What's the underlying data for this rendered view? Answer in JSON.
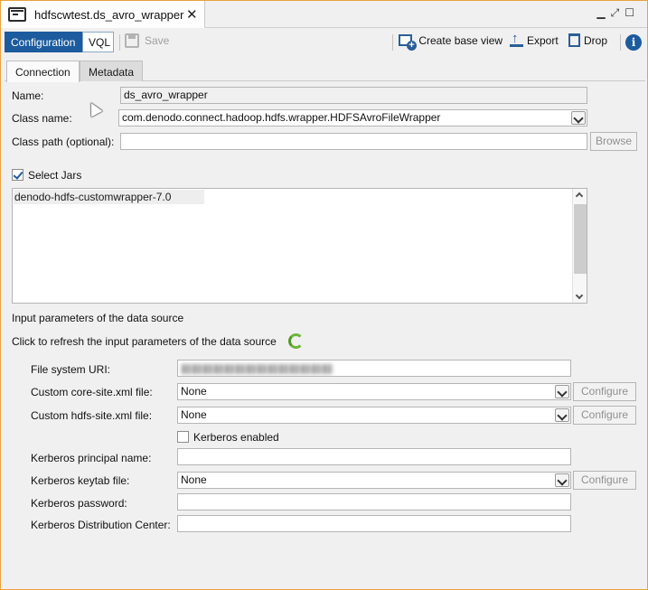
{
  "window": {
    "tab_title": "hdfscwtest.ds_avro_wrapper",
    "close_glyph": "✕",
    "controls": [
      "▁",
      "⤢",
      "☐"
    ]
  },
  "toolbar": {
    "configuration_label": "Configuration",
    "vql_label": "VQL",
    "save_label": "Save",
    "create_base_view_label": "Create base view",
    "export_label": "Export",
    "drop_label": "Drop",
    "info_glyph": "i",
    "accent_color": "#1c5b9e"
  },
  "tabs": {
    "connection": "Connection",
    "metadata": "Metadata"
  },
  "form": {
    "name_label": "Name:",
    "name_value": "ds_avro_wrapper",
    "class_name_label": "Class name:",
    "class_name_value": "com.denodo.connect.hadoop.hdfs.wrapper.HDFSAvroFileWrapper",
    "class_path_label": "Class path (optional):",
    "class_path_value": "",
    "browse_label": "Browse",
    "select_jars_label": "Select Jars",
    "select_jars_checked": true,
    "jars": [
      "denodo-hdfs-customwrapper-7.0"
    ],
    "input_params_heading": "Input parameters of the data source",
    "refresh_text": "Click to refresh the input parameters of the data source"
  },
  "params": {
    "file_system_uri_label": "File system URI:",
    "file_system_uri_value": "",
    "core_site_label": "Custom core-site.xml file:",
    "core_site_value": "None",
    "hdfs_site_label": "Custom hdfs-site.xml file:",
    "hdfs_site_value": "None",
    "configure_label": "Configure",
    "kerberos_enabled_label": "Kerberos enabled",
    "kerberos_enabled_checked": false,
    "kerberos_principal_label": "Kerberos principal name:",
    "kerberos_principal_value": "",
    "kerberos_keytab_label": "Kerberos keytab file:",
    "kerberos_keytab_value": "None",
    "kerberos_password_label": "Kerberos password:",
    "kerberos_password_value": "",
    "kerberos_kdc_label": "Kerberos Distribution Center:",
    "kerberos_kdc_value": ""
  }
}
